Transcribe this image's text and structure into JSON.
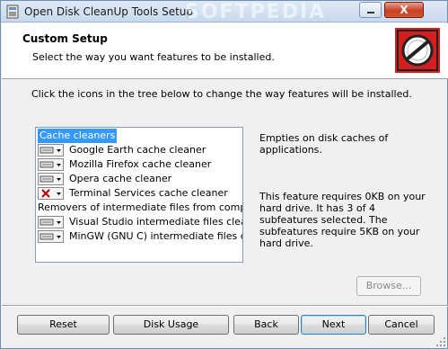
{
  "window": {
    "title": "Open Disk CleanUp Tools Setup",
    "watermark": "SOFTPEDIA"
  },
  "banner": {
    "title": "Custom Setup",
    "subtitle": "Select the way you want features to be installed."
  },
  "instruction": "Click the icons in the tree below to change the way features will be installed.",
  "tree": {
    "items": [
      {
        "label": "Cache cleaners",
        "selected": true,
        "icon": "none"
      },
      {
        "label": "Google Earth cache cleaner",
        "icon": "install-local-icon"
      },
      {
        "label": "Mozilla Firefox cache cleaner",
        "icon": "install-local-icon"
      },
      {
        "label": "Opera cache cleaner",
        "icon": "install-local-icon"
      },
      {
        "label": "Terminal Services cache cleaner",
        "icon": "not-installed-icon"
      },
      {
        "label": "Removers of intermediate files from compilation",
        "icon": "none"
      },
      {
        "label": "Visual Studio intermediate files cleaner",
        "icon": "install-local-icon"
      },
      {
        "label": "MinGW (GNU C) intermediate files cleaner",
        "icon": "install-local-icon"
      }
    ]
  },
  "description": {
    "summary": "Empties on disk caches of applications.",
    "details": "This feature requires 0KB on your hard drive. It has 3 of 4 subfeatures selected. The subfeatures require 5KB on your hard drive."
  },
  "buttons": {
    "browse": "Browse...",
    "reset": "Reset",
    "disk_usage": "Disk Usage",
    "back": "Back",
    "next": "Next",
    "cancel": "Cancel",
    "close": "X"
  },
  "colors": {
    "selection": "#3399ff",
    "close_button": "#c74026",
    "logo_red": "#d41f1f"
  }
}
